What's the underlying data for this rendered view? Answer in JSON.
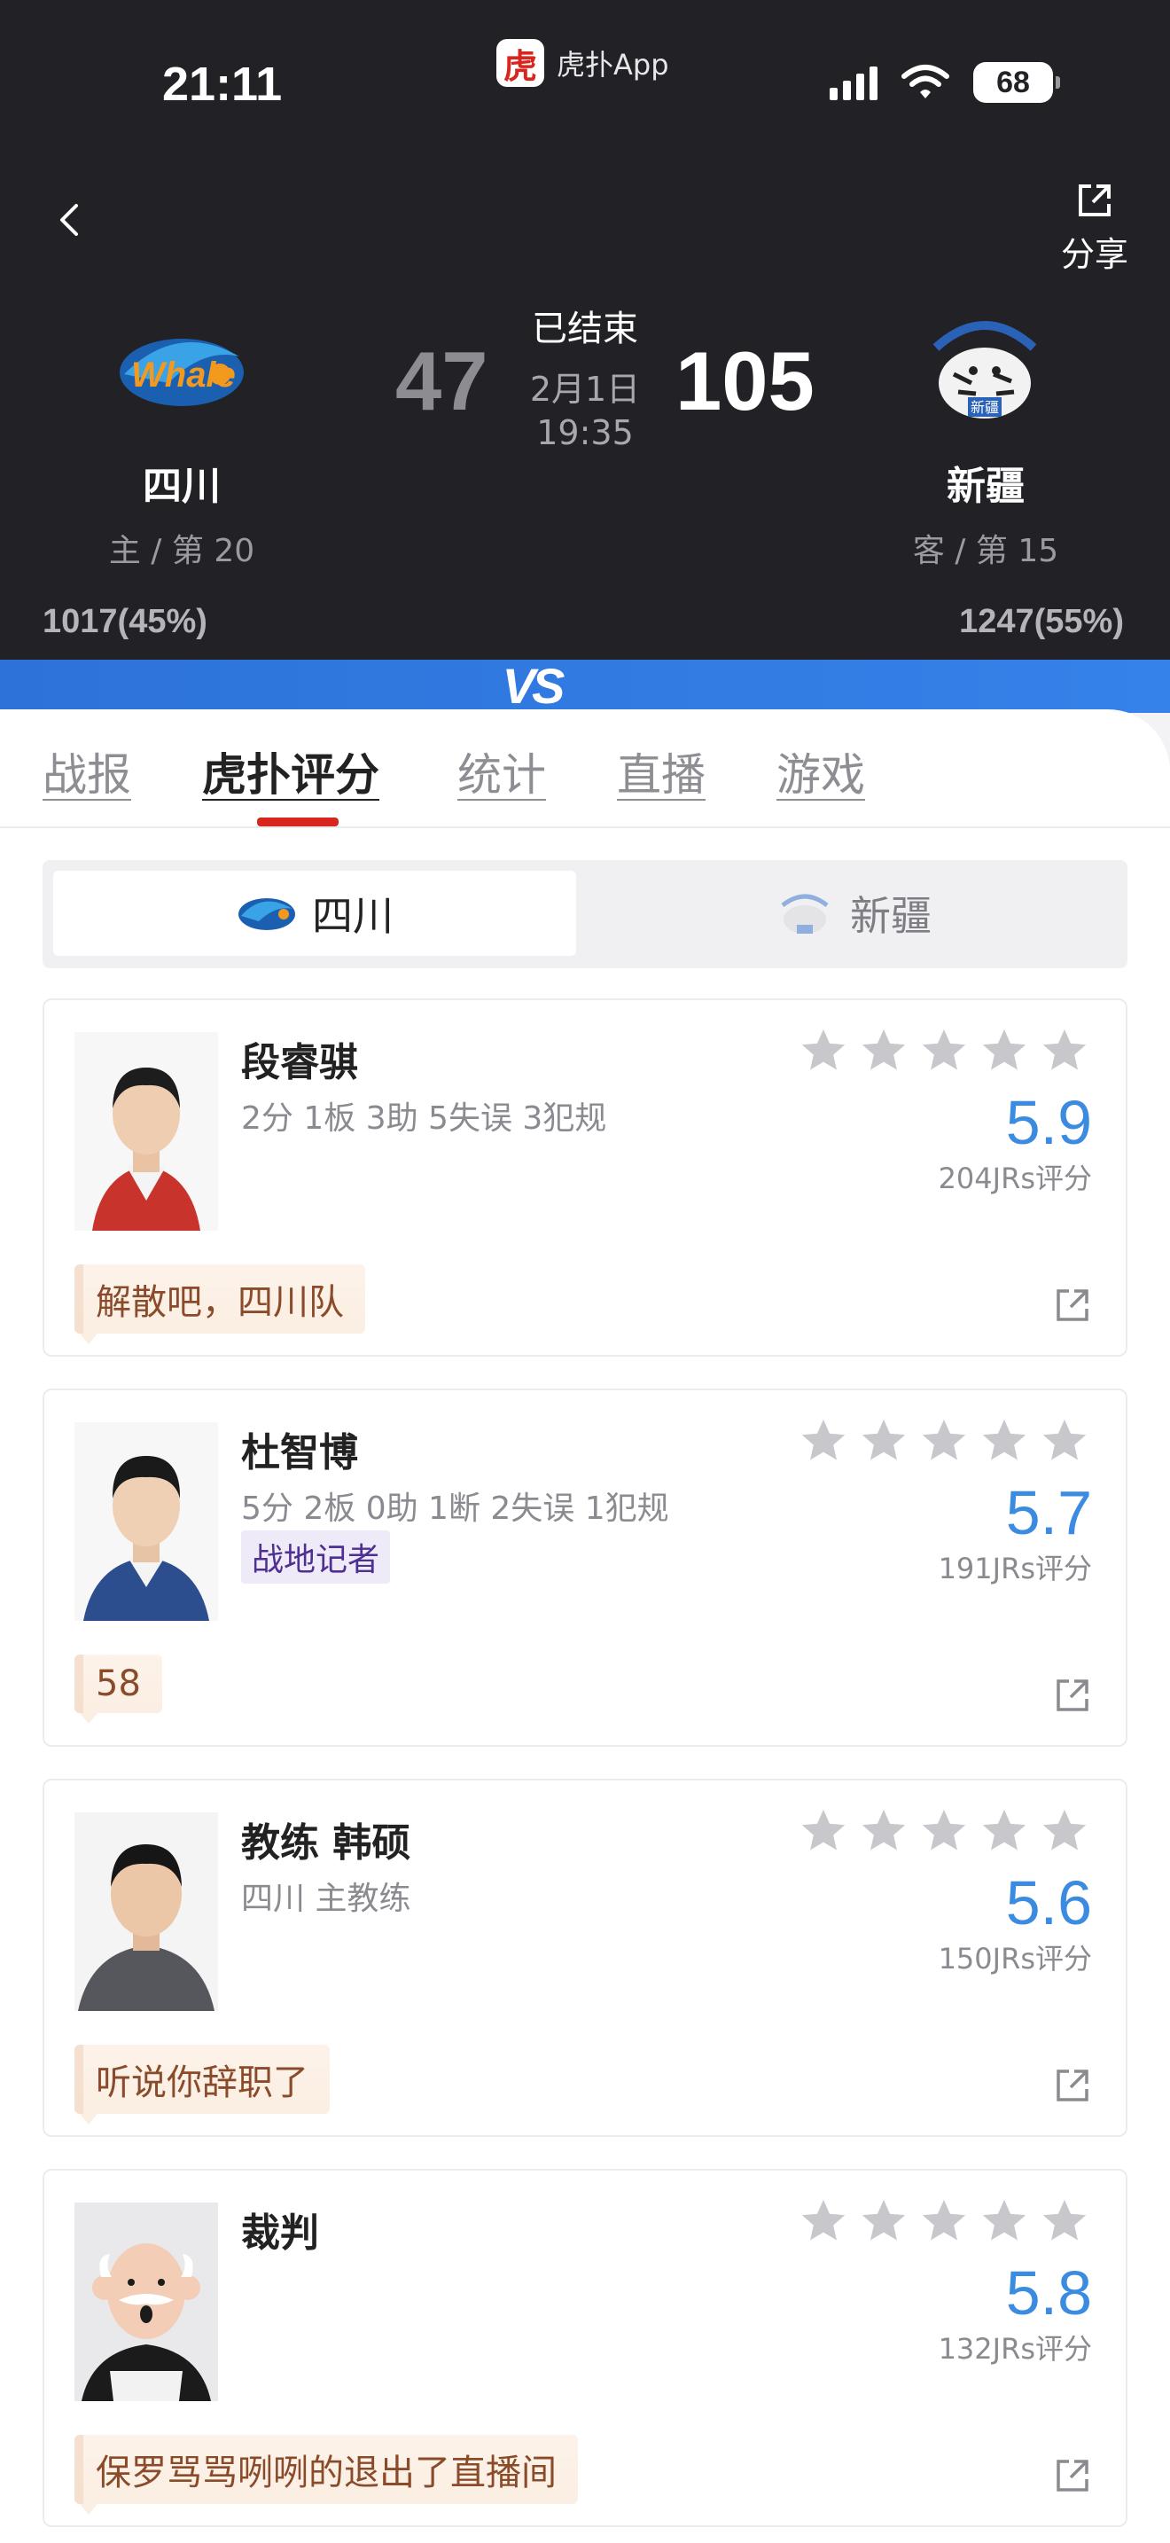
{
  "status_bar": {
    "time": "21:11",
    "app_name": "虎扑App",
    "app_logo_char": "虎",
    "battery": "68"
  },
  "header": {
    "share_label": "分享",
    "status": "已结束",
    "date": "2月1日",
    "time": "19:35",
    "home": {
      "name": "四川",
      "rank": "主 / 第 20",
      "score": "47",
      "votes": "1017(45%)"
    },
    "away": {
      "name": "新疆",
      "rank": "客 / 第 15",
      "score": "105",
      "votes": "1247(55%)"
    },
    "vs": "VS"
  },
  "tabs": [
    "战报",
    "虎扑评分",
    "统计",
    "直播",
    "游戏"
  ],
  "active_tab": "虎扑评分",
  "team_switch": {
    "home": "四川",
    "away": "新疆"
  },
  "cards": [
    {
      "name": "段睿骐",
      "stats": "2分 1板 3助 5失误 3犯规",
      "tag": "",
      "rating": "5.9",
      "raters": "204JRs评分",
      "comment": "解散吧，四川队"
    },
    {
      "name": "杜智博",
      "stats": "5分 2板 0助 1断 2失误 1犯规",
      "tag": "战地记者",
      "rating": "5.7",
      "raters": "191JRs评分",
      "comment": "58"
    },
    {
      "name": "教练 韩硕",
      "stats": "四川 主教练",
      "tag": "",
      "rating": "5.6",
      "raters": "150JRs评分",
      "comment": "听说你辞职了"
    },
    {
      "name": "裁判",
      "stats": "",
      "tag": "",
      "rating": "5.8",
      "raters": "132JRs评分",
      "comment": "保罗骂骂咧咧的退出了直播间"
    }
  ],
  "colors": {
    "accent_red": "#d8261f",
    "rating_blue": "#3b8be0",
    "header_bg": "#222226"
  }
}
